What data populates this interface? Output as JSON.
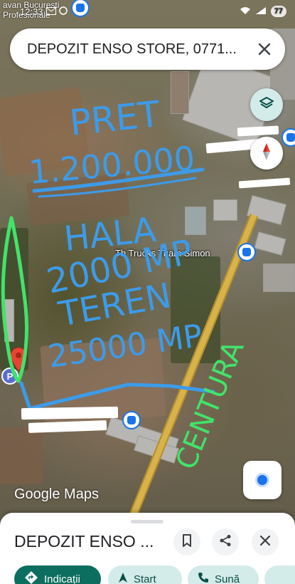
{
  "status_bar": {
    "time": "12:33",
    "battery": "77",
    "map_caption_lines": [
      "avan Bucuresti",
      "Profesionale"
    ]
  },
  "search": {
    "query": "DEPOZIT ENSO STORE, 0771..."
  },
  "map": {
    "poi_label": "Th Trucks Tuam Simon",
    "logo": "Google Maps",
    "annotation_text": [
      "PRET",
      "1.200.000",
      "HALA",
      "2000 MP",
      "TEREN",
      "25000 MP",
      "CENTURA"
    ]
  },
  "place": {
    "title": "DEPOZIT ENSO ..."
  },
  "actions": {
    "directions": "Indicații",
    "start": "Start",
    "call": "Sună"
  },
  "colors": {
    "accent_teal": "#0b6e5e",
    "chip_bg": "#d3ebe9",
    "annotation_blue": "#3d9be9",
    "annotation_green": "#41e36a"
  }
}
